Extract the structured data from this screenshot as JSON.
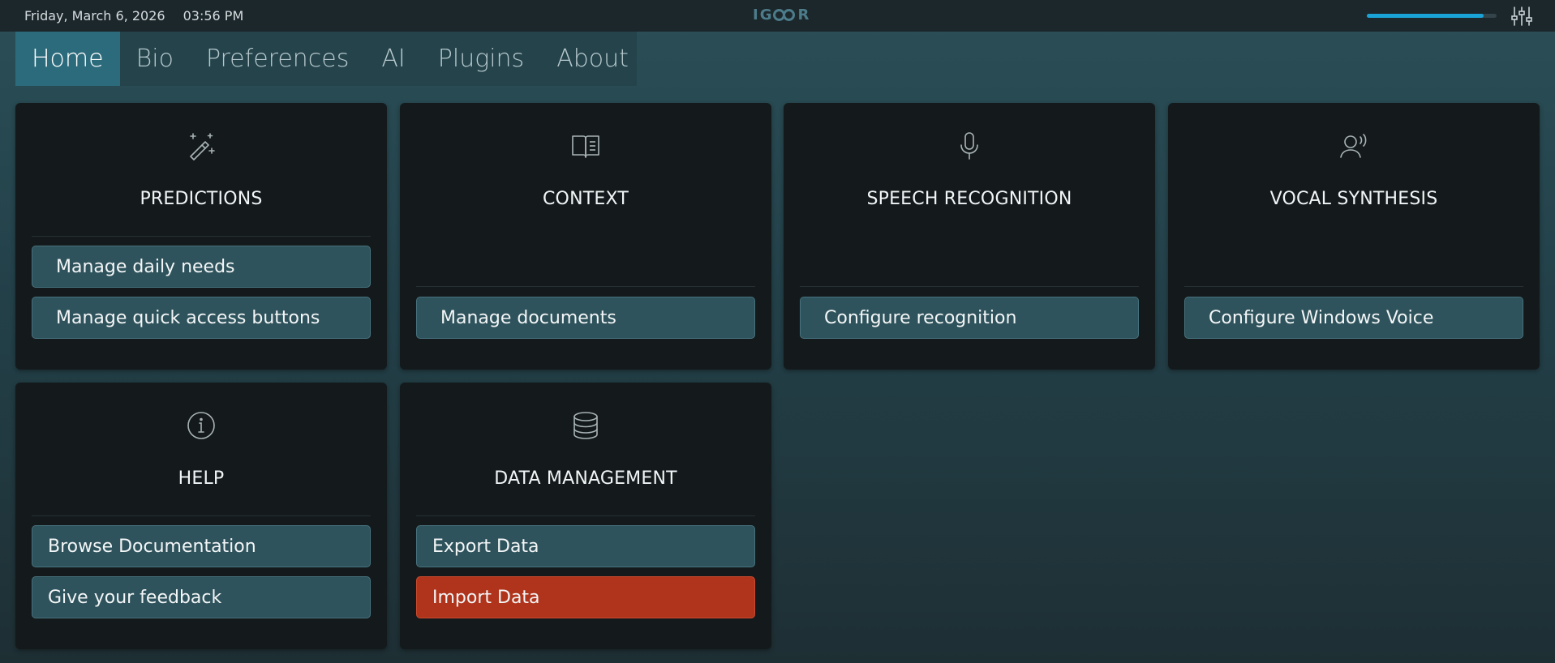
{
  "topbar": {
    "date": "Friday, March 6, 2026",
    "time": "03:56 PM",
    "logo": "IGOOR",
    "logo_left": "IG",
    "logo_right": "R",
    "volume_fraction": 0.9
  },
  "tabs": [
    {
      "label": "Home",
      "active": true
    },
    {
      "label": "Bio",
      "active": false
    },
    {
      "label": "Preferences",
      "active": false
    },
    {
      "label": "AI",
      "active": false
    },
    {
      "label": "Plugins",
      "active": false
    },
    {
      "label": "About",
      "active": false
    }
  ],
  "cards": {
    "predictions": {
      "title": "PREDICTIONS",
      "icon": "magic-wand-icon",
      "buttons": [
        "Manage daily needs",
        "Manage quick access buttons"
      ]
    },
    "context": {
      "title": "CONTEXT",
      "icon": "book-icon",
      "buttons": [
        "Manage documents"
      ]
    },
    "speech": {
      "title": "SPEECH RECOGNITION",
      "icon": "microphone-icon",
      "buttons": [
        "Configure recognition"
      ]
    },
    "vocal": {
      "title": "VOCAL SYNTHESIS",
      "icon": "speaking-person-icon",
      "buttons": [
        "Configure Windows Voice"
      ]
    },
    "help": {
      "title": "HELP",
      "icon": "info-icon",
      "buttons": [
        "Browse Documentation",
        "Give your feedback"
      ]
    },
    "data": {
      "title": "DATA MANAGEMENT",
      "icon": "database-icon",
      "buttons": [
        "Export Data",
        "Import Data"
      ]
    }
  },
  "colors": {
    "accent_tab": "#2c6b7c",
    "button": "#2f535c",
    "danger_button": "#b0341c",
    "volume": "#1aa3d6"
  }
}
